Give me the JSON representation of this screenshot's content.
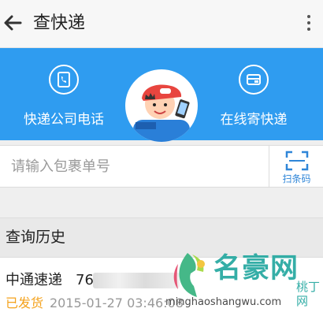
{
  "header": {
    "title": "查快递"
  },
  "hero": {
    "actions": [
      {
        "label": "快递公司电话",
        "icon": "phone-book-icon"
      },
      {
        "label": "在线寄快递",
        "icon": "box-icon"
      }
    ],
    "avatar_icon": "courier-avatar-icon",
    "background": "#2f9cf0"
  },
  "search": {
    "placeholder": "请输入包裹单号",
    "scan_label": "扫条码",
    "scan_icon": "barcode-scan-icon"
  },
  "history": {
    "title": "查询历史",
    "records": [
      {
        "carrier": "中通速递",
        "number_prefix": "76",
        "status": "已发货",
        "time": "2015-01-27 03:46:08"
      }
    ]
  },
  "watermark": {
    "title": "名豪网",
    "sub": "桃丁网",
    "url": "minghaoshangwu.com",
    "logo": "woman-profile-logo"
  },
  "colors": {
    "accent": "#2f9cf0",
    "status_shipped": "#f4a21c",
    "watermark": "#24a8a0"
  }
}
